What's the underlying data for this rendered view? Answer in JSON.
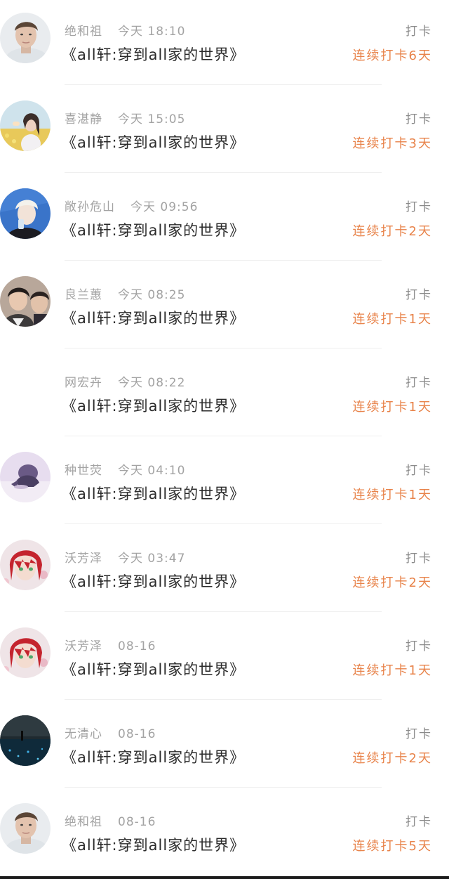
{
  "checkins": [
    {
      "name": "绝和祖",
      "time": "今天 18:10",
      "title": "《all轩:穿到all家的世界》",
      "action": "打卡",
      "streak": "连续打卡6天",
      "avatar": "young-man-portrait"
    },
    {
      "name": "喜湛静",
      "time": "今天 15:05",
      "title": "《all轩:穿到all家的世界》",
      "action": "打卡",
      "streak": "连续打卡3天",
      "avatar": "girl-in-flower-field"
    },
    {
      "name": "敞孙危山",
      "time": "今天 09:56",
      "title": "《all轩:穿到all家的世界》",
      "action": "打卡",
      "streak": "连续打卡2天",
      "avatar": "blond-man-blue-background"
    },
    {
      "name": "良兰蕙",
      "time": "今天 08:25",
      "title": "《all轩:穿到all家的世界》",
      "action": "打卡",
      "streak": "连续打卡1天",
      "avatar": "two-young-men"
    },
    {
      "name": "网宏卉",
      "time": "今天 08:22",
      "title": "《all轩:穿到all家的世界》",
      "action": "打卡",
      "streak": "连续打卡1天",
      "avatar": "none"
    },
    {
      "name": "种世荧",
      "time": "今天 04:10",
      "title": "《all轩:穿到all家的世界》",
      "action": "打卡",
      "streak": "连续打卡1天",
      "avatar": "anime-figure-purple"
    },
    {
      "name": "沃芳泽",
      "time": "今天 03:47",
      "title": "《all轩:穿到all家的世界》",
      "action": "打卡",
      "streak": "连续打卡2天",
      "avatar": "anime-red-hair"
    },
    {
      "name": "沃芳泽",
      "time": "08-16",
      "title": "《all轩:穿到all家的世界》",
      "action": "打卡",
      "streak": "连续打卡1天",
      "avatar": "anime-red-hair"
    },
    {
      "name": "无清心",
      "time": "08-16",
      "title": "《all轩:穿到all家的世界》",
      "action": "打卡",
      "streak": "连续打卡2天",
      "avatar": "night-sea-scene"
    },
    {
      "name": "绝和祖",
      "time": "08-16",
      "title": "《all轩:穿到all家的世界》",
      "action": "打卡",
      "streak": "连续打卡5天",
      "avatar": "young-man-portrait"
    }
  ],
  "colors": {
    "streak": "#e8834a",
    "meta": "#a3a3a3",
    "title": "#2a2a2a",
    "action": "#8a8a8a",
    "divider": "#efefef"
  }
}
